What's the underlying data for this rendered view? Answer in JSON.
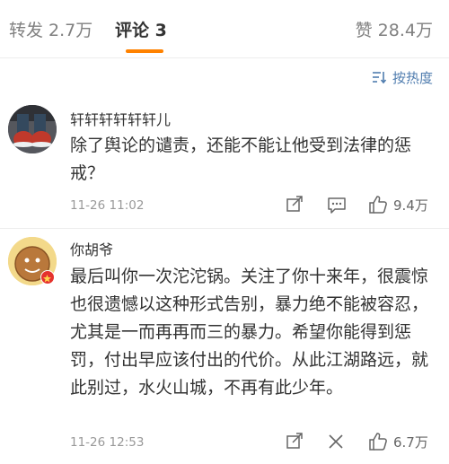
{
  "tabs": {
    "repost": "转发 2.7万",
    "comments": "评论 3",
    "likes": "赞 28.4万",
    "accent_color": "#ff8200"
  },
  "sort": {
    "label": "按热度",
    "icon": "sort-icon",
    "color": "#507daf"
  },
  "comments": [
    {
      "username": "轩轩轩轩轩轩儿",
      "text": "除了舆论的谴责，还能不能让他受到法律的惩戒？",
      "time": "11-26 11:02",
      "likes": "9.4万"
    },
    {
      "username": "你胡爷",
      "text": "最后叫你一次沱沱锅。关注了你十来年，很震惊也很遗憾以这种形式告别，暴力绝不能被容忍，尤其是一而再再而三的暴力。希望你能得到惩罚，付出早应该付出的代价。从此江湖路远，就此别过，水火山城，不再有此少年。",
      "time": "11-26 12:53",
      "likes": "6.7万"
    }
  ]
}
